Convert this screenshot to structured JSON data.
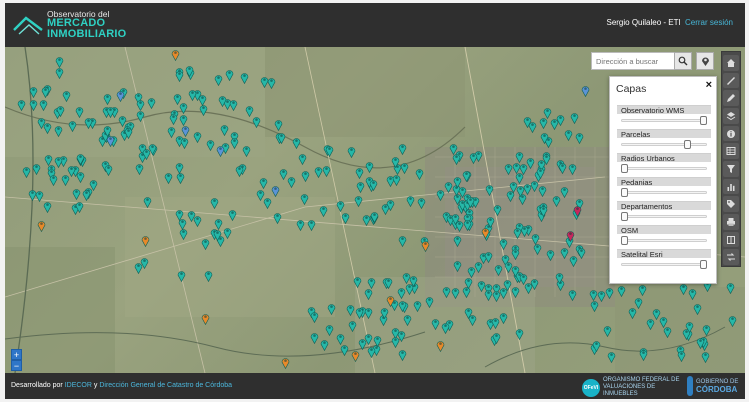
{
  "header": {
    "logo_top": "Observatorio del",
    "logo_mid": "MERCADO",
    "logo_bottom": "INMOBILIARIO",
    "user_name": "Sergio Quilaleo - ETI",
    "logout_label": "Cerrar sesión"
  },
  "search": {
    "placeholder": "Dirección a buscar",
    "search_icon": "search-icon",
    "location_icon": "location-pin-icon"
  },
  "toolbar": {
    "tools": [
      "home-icon",
      "ruler-icon",
      "draw-icon",
      "layers-icon",
      "info-icon",
      "table-icon",
      "filter-icon",
      "chart-icon",
      "tag-icon",
      "print-icon",
      "expand-icon",
      "swap-icon"
    ]
  },
  "layers": {
    "title": "Capas",
    "close": "×",
    "items": [
      {
        "label": "Observatorio WMS",
        "opacity": 1.0
      },
      {
        "label": "Parcelas",
        "opacity": 0.8
      },
      {
        "label": "Radios Urbanos",
        "opacity": 0.0
      },
      {
        "label": "Pedanias",
        "opacity": 0.0
      },
      {
        "label": "Departamentos",
        "opacity": 0.0
      },
      {
        "label": "OSM",
        "opacity": 0.0
      },
      {
        "label": "Satelital Esri",
        "opacity": 1.0
      }
    ]
  },
  "zoom": {
    "in": "+",
    "out": "−"
  },
  "footer": {
    "credits_prefix": "Desarrollado por",
    "credits_link1": "IDECOR",
    "credits_join": "y",
    "credits_link2": "Dirección General de Catastro de Córdoba",
    "ofvi_badge": "OFeVI",
    "ofvi_name": "ORGANISMO FEDERAL DE VALUACIONES DE INMUEBLES",
    "gob_sub": "GOBIERNO DE",
    "gob_main": "CÓRDOBA"
  },
  "colors": {
    "teal": "#26b8a8",
    "blue": "#5b93d6",
    "orange": "#e8892a",
    "magenta": "#c8265c"
  }
}
